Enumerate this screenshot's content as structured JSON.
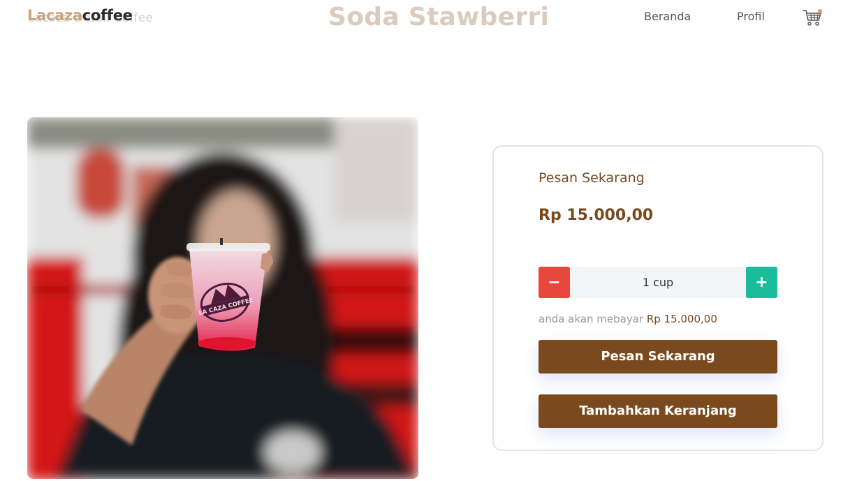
{
  "header": {
    "breadcrumb_ghost": "Lacaza Detail Coffee",
    "brand_part1": "Lacaza",
    "brand_part2": "coffee",
    "page_title": "Soda Stawberri",
    "nav": {
      "home": "Beranda",
      "profile": "Profil"
    },
    "cart_icon": "shopping-cart-icon"
  },
  "product": {
    "image_alt": "Soda Stawberri",
    "cup_print": "LA CAZA COFFEE"
  },
  "order": {
    "heading": "Pesan Sekarang",
    "price": "Rp 15.000,00",
    "quantity": "1 cup",
    "minus_label": "−",
    "plus_label": "+",
    "pay_note": "anda akan mebayar",
    "pay_amount": "Rp 15.000,00",
    "order_button": "Pesan Sekarang",
    "cart_button": "Tambahkan Keranjang"
  },
  "colors": {
    "brand_brown": "#7a4a1e",
    "minus_red": "#e8473c",
    "plus_green": "#1abc9c",
    "title_beige": "#dbcbbd"
  }
}
